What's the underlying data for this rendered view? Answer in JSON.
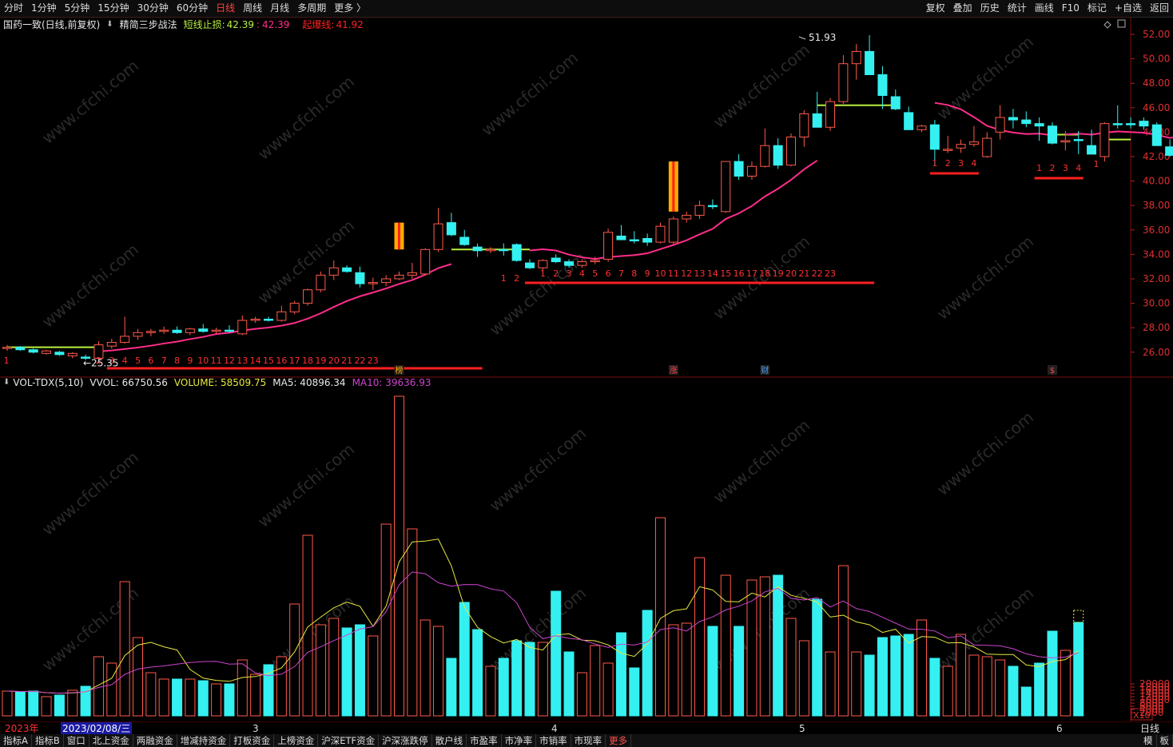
{
  "toolbar": {
    "periods": [
      "分时",
      "1分钟",
      "5分钟",
      "15分钟",
      "30分钟",
      "60分钟",
      "日线",
      "周线",
      "月线",
      "多周期",
      "更多 〉"
    ],
    "active_period": "日线",
    "right": [
      "复权",
      "叠加",
      "历史",
      "统计",
      "画线",
      "F10",
      "标记",
      "+自选",
      "返回"
    ]
  },
  "main_info": {
    "stock": "国药一致(日线,前复权)",
    "indicator_icon": "down-arrow-icon",
    "indicator": "精简三步战法",
    "stop_label": "短线止损:",
    "stop_value1": "42.39",
    "stop_value2": "42.39",
    "blast_label": "起爆线:",
    "blast_value": "41.92"
  },
  "vol_info": {
    "name": "VOL-TDX(5,10)",
    "vvol": "VVOL: 66750.56",
    "volume": "VOLUME: 58509.75",
    "ma5": "MA5: 40896.34",
    "ma10": "MA10: 39636.93"
  },
  "price_axis": [
    "52.00",
    "50.00",
    "48.00",
    "46.00",
    "44.00",
    "42.00",
    "40.00",
    "38.00",
    "36.00",
    "34.00",
    "32.00",
    "30.00",
    "28.00",
    "26.00"
  ],
  "vol_axis": [
    "20000",
    "18000",
    "16000",
    "14000",
    "12000",
    "10000",
    "8000",
    "6000",
    "4000",
    "2000"
  ],
  "vol_unit": "X10",
  "annotations": {
    "high": "51.93",
    "low": "25.35"
  },
  "markers": [
    "榜",
    "涨",
    "财",
    "$"
  ],
  "dates": {
    "year": "2023年",
    "selected": "2023/02/08/三",
    "months": [
      "3",
      "4",
      "5",
      "6"
    ]
  },
  "period_label": "日线",
  "bottom_tabs": [
    "指标A",
    "指标B",
    "窗口",
    "北上资金",
    "两融资金",
    "增减持资金",
    "打板资金",
    "上榜资金",
    "沪深ETF资金",
    "沪深涨跌停",
    "散户线",
    "市盈率",
    "市净率",
    "市销率",
    "市现率",
    "更多"
  ],
  "bottom_right": [
    "模",
    "板"
  ],
  "watermark": "www.cfchi.com",
  "colors": {
    "up": "#ff5a4a",
    "down": "#35f0f0",
    "ma_pink": "#ff2d8a",
    "ma_yellow": "#e8e840",
    "ma_magenta": "#cc44cc",
    "stop_line": "#b8f040",
    "blast_bar": "#ff2020"
  },
  "chart_data": {
    "type": "candlestick",
    "candles": [
      [
        26.3,
        26.6,
        26.1,
        26.4
      ],
      [
        26.4,
        26.5,
        26.1,
        26.2
      ],
      [
        26.2,
        26.3,
        25.9,
        26.0
      ],
      [
        25.9,
        26.2,
        25.8,
        26.1
      ],
      [
        26.0,
        26.1,
        25.7,
        25.8
      ],
      [
        25.7,
        26.0,
        25.5,
        25.9
      ],
      [
        25.6,
        25.8,
        25.35,
        25.5
      ],
      [
        25.5,
        26.9,
        25.4,
        26.6
      ],
      [
        26.5,
        27.1,
        26.3,
        26.8
      ],
      [
        26.8,
        28.9,
        26.7,
        27.3
      ],
      [
        27.3,
        27.9,
        27.0,
        27.6
      ],
      [
        27.6,
        27.9,
        27.3,
        27.7
      ],
      [
        27.7,
        28.1,
        27.5,
        27.8
      ],
      [
        27.8,
        28.1,
        27.5,
        27.6
      ],
      [
        27.6,
        28.0,
        27.4,
        27.9
      ],
      [
        27.9,
        28.3,
        27.6,
        27.7
      ],
      [
        27.7,
        28.0,
        27.5,
        27.8
      ],
      [
        27.8,
        28.2,
        27.6,
        27.7
      ],
      [
        27.5,
        29.0,
        27.4,
        28.6
      ],
      [
        28.6,
        28.9,
        28.4,
        28.7
      ],
      [
        28.7,
        28.9,
        28.5,
        28.6
      ],
      [
        28.6,
        29.8,
        28.5,
        29.3
      ],
      [
        29.3,
        30.2,
        29.1,
        30.0
      ],
      [
        30.0,
        31.2,
        29.8,
        31.1
      ],
      [
        31.1,
        32.6,
        30.9,
        32.3
      ],
      [
        32.3,
        33.5,
        31.9,
        32.9
      ],
      [
        32.9,
        33.1,
        32.5,
        32.6
      ],
      [
        32.5,
        33.0,
        31.3,
        31.6
      ],
      [
        31.6,
        32.1,
        31.1,
        31.7
      ],
      [
        31.7,
        32.3,
        31.4,
        32.0
      ],
      [
        32.0,
        32.6,
        31.9,
        32.3
      ],
      [
        32.3,
        33.3,
        32.0,
        32.5
      ],
      [
        32.4,
        34.5,
        32.3,
        34.4
      ],
      [
        34.4,
        37.8,
        34.2,
        36.5
      ],
      [
        36.6,
        37.4,
        35.5,
        35.6
      ],
      [
        35.4,
        36.0,
        34.7,
        34.8
      ],
      [
        34.6,
        34.9,
        33.8,
        34.3
      ],
      [
        34.3,
        34.6,
        34.1,
        34.4
      ],
      [
        34.4,
        34.9,
        33.9,
        34.3
      ],
      [
        34.8,
        34.9,
        33.4,
        33.5
      ],
      [
        33.3,
        33.6,
        32.8,
        32.9
      ],
      [
        32.9,
        33.6,
        32.5,
        33.5
      ],
      [
        33.7,
        34.0,
        33.3,
        33.4
      ],
      [
        33.4,
        33.6,
        32.9,
        33.1
      ],
      [
        33.1,
        33.6,
        32.9,
        33.4
      ],
      [
        33.4,
        33.8,
        33.2,
        33.5
      ],
      [
        33.6,
        36.1,
        33.4,
        35.8
      ],
      [
        35.5,
        36.4,
        35.3,
        35.2
      ],
      [
        35.2,
        35.9,
        34.9,
        35.1
      ],
      [
        35.3,
        35.7,
        34.7,
        35.0
      ],
      [
        35.0,
        36.6,
        34.9,
        36.3
      ],
      [
        35.0,
        37.1,
        34.8,
        36.9
      ],
      [
        36.9,
        37.5,
        36.6,
        37.2
      ],
      [
        37.2,
        38.4,
        36.9,
        38.0
      ],
      [
        38.0,
        38.5,
        37.7,
        37.9
      ],
      [
        37.5,
        41.6,
        37.4,
        41.6
      ],
      [
        41.6,
        42.2,
        40.1,
        40.4
      ],
      [
        40.4,
        41.6,
        40.1,
        41.2
      ],
      [
        41.2,
        44.3,
        41.1,
        42.9
      ],
      [
        42.9,
        43.5,
        41.0,
        41.3
      ],
      [
        41.3,
        43.9,
        41.2,
        43.6
      ],
      [
        43.6,
        45.8,
        42.8,
        45.5
      ],
      [
        45.5,
        47.3,
        44.5,
        44.4
      ],
      [
        44.4,
        46.8,
        44.1,
        46.5
      ],
      [
        46.5,
        50.3,
        46.3,
        49.6
      ],
      [
        49.6,
        51.2,
        48.3,
        50.6
      ],
      [
        50.6,
        51.93,
        49.5,
        48.7
      ],
      [
        48.7,
        49.4,
        45.9,
        47.0
      ],
      [
        46.9,
        47.5,
        45.8,
        45.9
      ],
      [
        45.6,
        46.1,
        44.2,
        44.2
      ],
      [
        44.2,
        44.6,
        44.0,
        44.5
      ],
      [
        44.6,
        45.0,
        41.3,
        42.6
      ],
      [
        42.5,
        43.7,
        42.3,
        42.6
      ],
      [
        42.7,
        43.4,
        42.3,
        43.0
      ],
      [
        43.0,
        44.5,
        42.8,
        43.2
      ],
      [
        42.0,
        44.0,
        41.9,
        43.5
      ],
      [
        44.0,
        46.2,
        43.4,
        45.2
      ],
      [
        45.2,
        45.9,
        44.3,
        45.0
      ],
      [
        45.0,
        45.7,
        44.4,
        44.7
      ],
      [
        44.7,
        45.2,
        43.3,
        44.5
      ],
      [
        44.5,
        44.8,
        43.0,
        43.1
      ],
      [
        43.2,
        44.1,
        42.5,
        43.3
      ],
      [
        43.4,
        44.1,
        42.2,
        43.3
      ],
      [
        42.9,
        44.2,
        42.3,
        42.2
      ],
      [
        42.0,
        44.8,
        41.6,
        44.7
      ],
      [
        44.7,
        46.2,
        44.3,
        44.6
      ],
      [
        44.7,
        45.2,
        44.3,
        44.6
      ],
      [
        44.9,
        45.2,
        44.2,
        44.5
      ],
      [
        44.6,
        44.8,
        43.0,
        42.9
      ],
      [
        42.8,
        43.4,
        42.0,
        42.1
      ],
      [
        42.0,
        45.0,
        41.8,
        44.7
      ]
    ],
    "volume": [
      1550,
      1500,
      1550,
      1200,
      1300,
      1600,
      1850,
      3700,
      3300,
      8400,
      4900,
      2700,
      2300,
      2300,
      2300,
      2200,
      2000,
      2000,
      3500,
      2600,
      3200,
      3700,
      7000,
      11300,
      5700,
      6100,
      5500,
      5700,
      5000,
      12000,
      20000,
      11700,
      6000,
      5600,
      3600,
      7100,
      5400,
      3100,
      3600,
      4700,
      4600,
      4600,
      7800,
      4000,
      2700,
      4400,
      3300,
      5200,
      3000,
      6600,
      12400,
      5700,
      5800,
      9900,
      5600,
      8800,
      5600,
      8500,
      8700,
      8800,
      6100,
      4700,
      7300,
      4000,
      9400,
      4000,
      3800,
      4900,
      5000,
      5100,
      6000,
      3600,
      3100,
      5100,
      3800,
      3700,
      3500,
      3100,
      1800,
      3300,
      5300,
      4100,
      5850
    ],
    "ma5_approx": true,
    "ma10_approx": true
  }
}
